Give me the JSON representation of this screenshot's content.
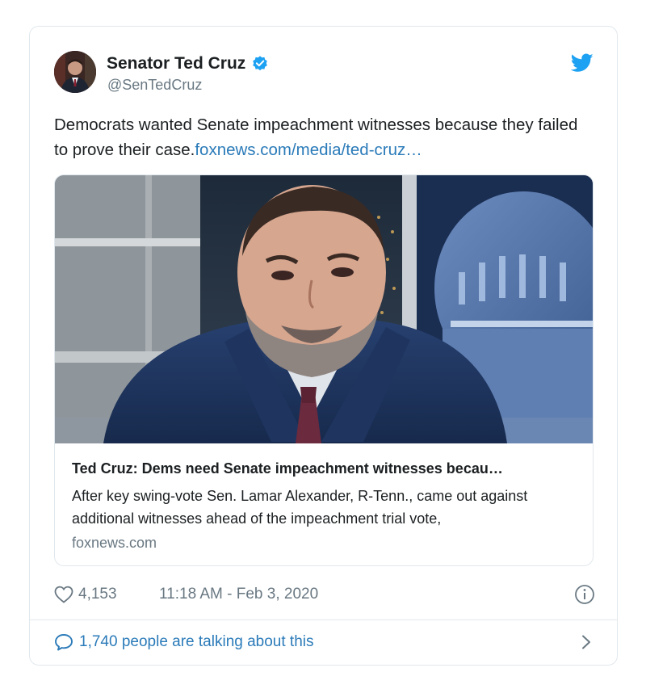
{
  "tweet": {
    "display_name": "Senator Ted Cruz",
    "handle": "@SenTedCruz",
    "verified_icon": "verified-badge-icon",
    "brand_icon": "twitter-bird-icon",
    "text": "Democrats wanted Senate impeachment witnesses because they failed to prove their case.",
    "link_text": "foxnews.com/media/ted-cruz…"
  },
  "link_card": {
    "title": "Ted Cruz: Dems need Senate impeachment witnesses becau…",
    "description": "After key swing-vote Sen. Lamar Alexander, R-Tenn., came out against additional witnesses ahead of the impeachment trial vote,",
    "domain": "foxnews.com"
  },
  "meta": {
    "likes": "4,153",
    "timestamp": "11:18 AM - Feb 3, 2020"
  },
  "footer": {
    "talking": "1,740 people are talking about this"
  },
  "colors": {
    "brand_blue": "#1da1f2",
    "link_blue": "#2b7bb9",
    "muted_gray": "#697882",
    "border": "#e1e8ed"
  }
}
